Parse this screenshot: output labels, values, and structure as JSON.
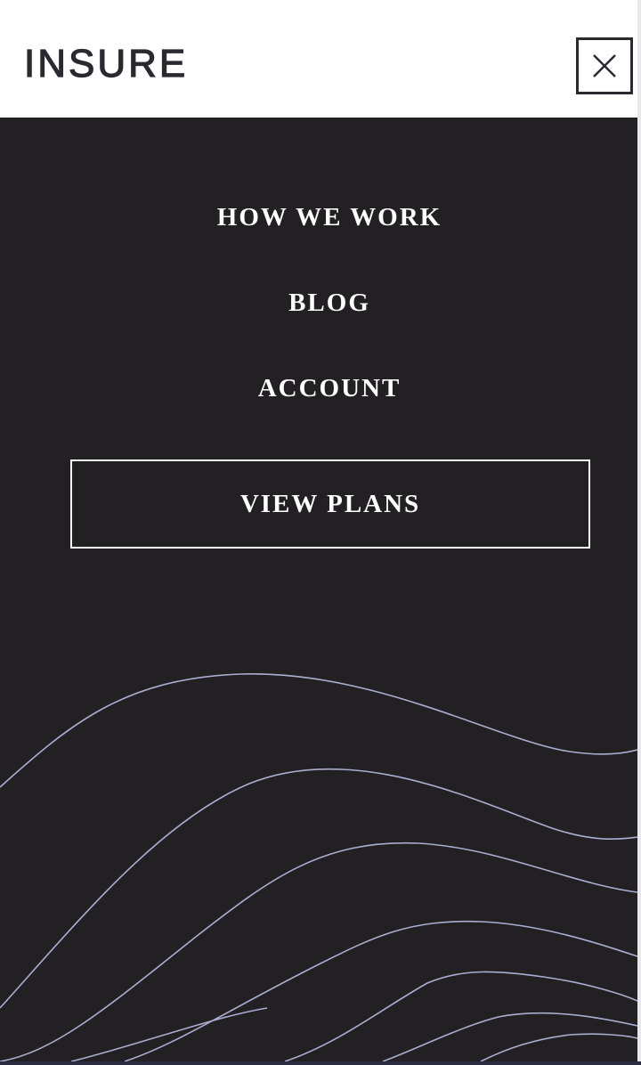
{
  "header": {
    "logo": "INSURE",
    "close_icon": "close-icon"
  },
  "menu": {
    "items": [
      {
        "label": "HOW WE WORK"
      },
      {
        "label": "BLOG"
      },
      {
        "label": "ACCOUNT"
      }
    ],
    "cta_label": "VIEW PLANS"
  },
  "colors": {
    "background": "#232024",
    "text": "#ffffff",
    "wave_line": "#a9aed1",
    "logo": "#2c2830"
  }
}
